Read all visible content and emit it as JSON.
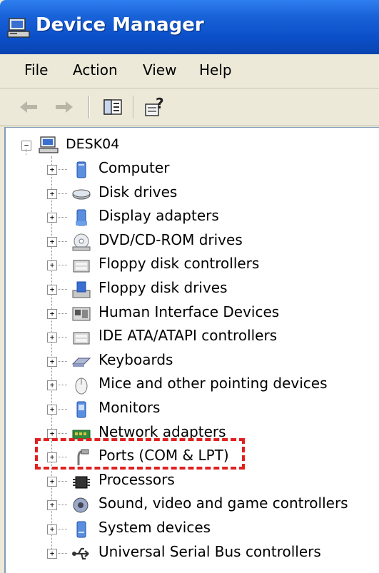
{
  "window": {
    "title": "Device Manager"
  },
  "menu": {
    "items": [
      "File",
      "Action",
      "View",
      "Help"
    ]
  },
  "toolbar": {
    "buttons": [
      "back-icon",
      "forward-icon",
      "show-hide-tree-icon",
      "help-icon"
    ]
  },
  "tree": {
    "root": "DESK04",
    "items": [
      {
        "label": "Computer",
        "icon": "computer-icon"
      },
      {
        "label": "Disk drives",
        "icon": "disk-drive-icon"
      },
      {
        "label": "Display adapters",
        "icon": "display-adapter-icon"
      },
      {
        "label": "DVD/CD-ROM drives",
        "icon": "dvd-drive-icon"
      },
      {
        "label": "Floppy disk controllers",
        "icon": "controller-icon"
      },
      {
        "label": "Floppy disk drives",
        "icon": "floppy-drive-icon"
      },
      {
        "label": "Human Interface Devices",
        "icon": "hid-icon"
      },
      {
        "label": "IDE ATA/ATAPI controllers",
        "icon": "controller-icon"
      },
      {
        "label": "Keyboards",
        "icon": "keyboard-icon"
      },
      {
        "label": "Mice and other pointing devices",
        "icon": "mouse-icon"
      },
      {
        "label": "Monitors",
        "icon": "monitor-icon"
      },
      {
        "label": "Network adapters",
        "icon": "network-adapter-icon"
      },
      {
        "label": "Ports (COM & LPT)",
        "icon": "port-icon",
        "highlighted": true
      },
      {
        "label": "Processors",
        "icon": "processor-icon"
      },
      {
        "label": "Sound, video and game controllers",
        "icon": "sound-icon"
      },
      {
        "label": "System devices",
        "icon": "system-device-icon"
      },
      {
        "label": "Universal Serial Bus controllers",
        "icon": "usb-icon"
      }
    ]
  },
  "colors": {
    "titlebar": "#0b4fc8",
    "highlight": "#e02020"
  }
}
